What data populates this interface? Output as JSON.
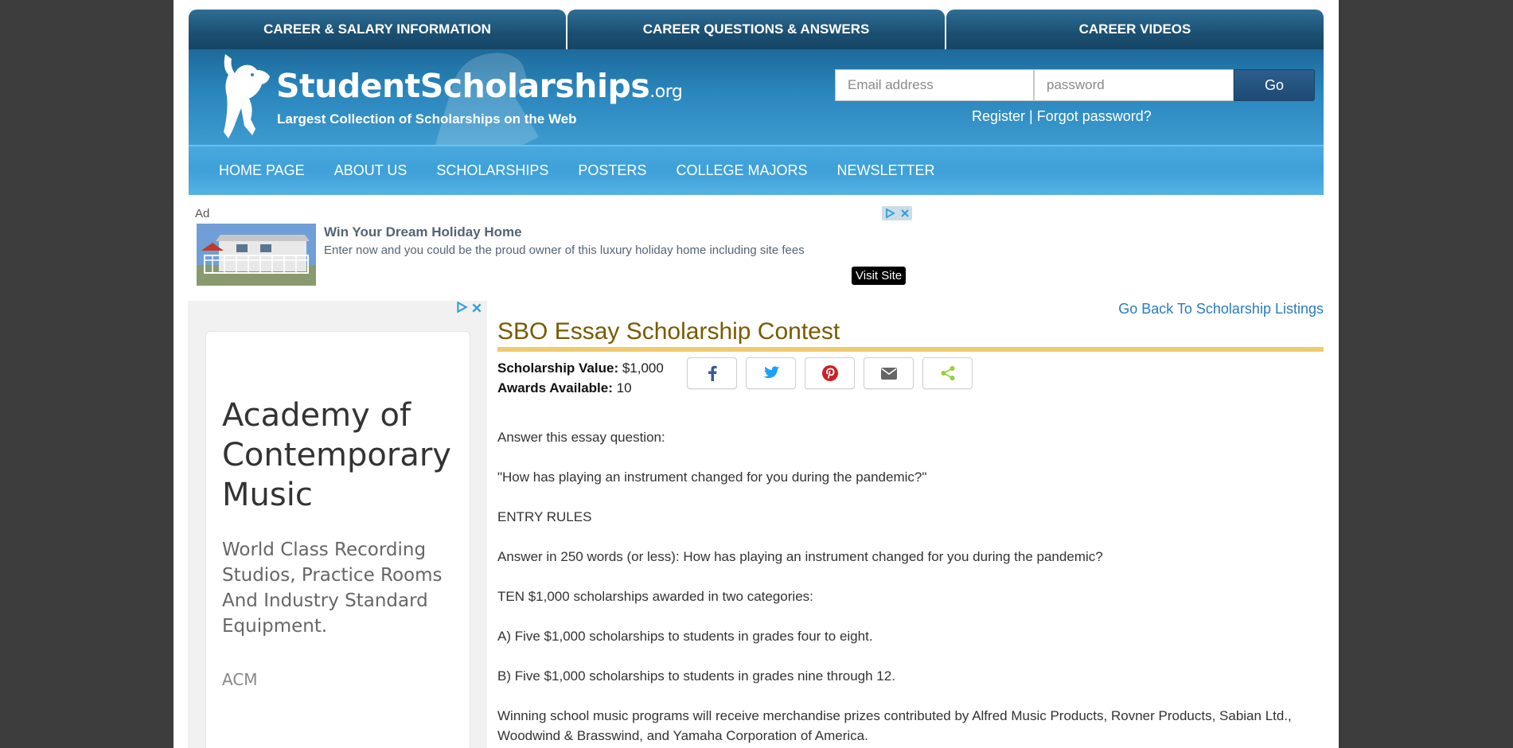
{
  "career_tabs": [
    "CAREER & SALARY INFORMATION",
    "CAREER QUESTIONS & ANSWERS",
    "CAREER VIDEOS"
  ],
  "brand": {
    "name": "StudentScholarships",
    "tld": ".org",
    "tagline": "Largest Collection of Scholarships on the Web"
  },
  "login": {
    "email_placeholder": "Email address",
    "password_placeholder": "password",
    "go_label": "Go",
    "register": "Register",
    "separator": "|",
    "forgot": "Forgot password?"
  },
  "nav": [
    "HOME PAGE",
    "ABOUT US",
    "SCHOLARSHIPS",
    "POSTERS",
    "COLLEGE MAJORS",
    "NEWSLETTER"
  ],
  "top_ad": {
    "label": "Ad",
    "headline": "Win Your Dream Holiday Home",
    "body": "Enter now and you could be the proud owner of this luxury holiday home including site fees",
    "cta": "Visit Site"
  },
  "side_ad": {
    "title": "Academy of Contemporary Music",
    "description": "World Class Recording Studios, Practice Rooms And Industry Standard Equipment.",
    "brand": "ACM"
  },
  "back_link": "Go Back To Scholarship Listings",
  "scholarship": {
    "title": "SBO Essay Scholarship Contest",
    "value_label": "Scholarship Value:",
    "value": "$1,000",
    "awards_label": "Awards Available:",
    "awards": "10"
  },
  "share": [
    {
      "name": "facebook-icon",
      "color": "#3b5998"
    },
    {
      "name": "twitter-icon",
      "color": "#1da1f2"
    },
    {
      "name": "pinterest-icon",
      "color": "#cb2027"
    },
    {
      "name": "email-icon",
      "color": "#666666"
    },
    {
      "name": "share-icon",
      "color": "#95d03a"
    }
  ],
  "body": [
    "Answer this essay question:",
    "\"How has playing an instrument changed for you during the pandemic?\"",
    "ENTRY RULES",
    "Answer in 250 words (or less): How has playing an instrument changed for you during the pandemic?",
    "TEN $1,000 scholarships awarded in two categories:",
    "A) Five $1,000 scholarships to students in grades four to eight.",
    "B) Five $1,000 scholarships to students in grades nine through 12.",
    "Winning school music programs will receive merchandise prizes contributed by Alfred Music Products, Rovner Products, Sabian Ltd., Woodwind & Brasswind, and Yamaha Corporation of America."
  ]
}
